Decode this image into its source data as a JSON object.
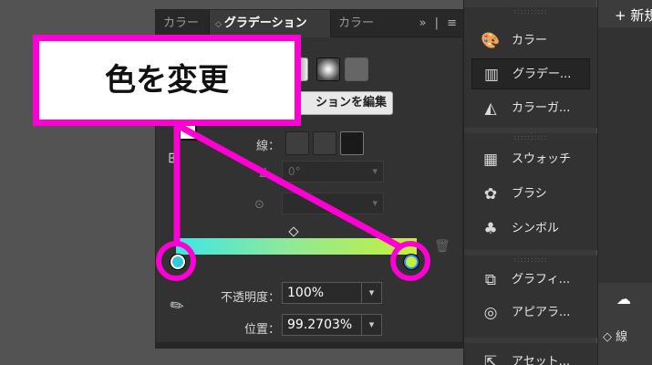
{
  "tabs": [
    {
      "label": "カラー",
      "state": "inactive"
    },
    {
      "label": "グラデーション",
      "state": "active"
    },
    {
      "label": "カラー",
      "state": "inactive"
    }
  ],
  "tab_tools": {
    "collapse": "»",
    "divider": "|",
    "menu": "≡"
  },
  "gradient_panel": {
    "edit_button_label": "ションを編集",
    "stroke_label": "線：",
    "angle_value": "0°",
    "aspect_value": "",
    "opacity_label": "不透明度：",
    "opacity_value": "100%",
    "position_label": "位置：",
    "position_value": "99.2703%",
    "stop_left_color": "#2fcbd8",
    "stop_right_color": "#c6ef3c"
  },
  "dock": {
    "items": [
      {
        "label": "カラー",
        "icon": "palette-icon"
      },
      {
        "label": "グラデー...",
        "icon": "gradient-icon",
        "active": true
      },
      {
        "label": "カラーガ...",
        "icon": "color-guide-icon"
      },
      {
        "label": "スウォッチ",
        "icon": "swatches-icon"
      },
      {
        "label": "ブラシ",
        "icon": "brush-icon"
      },
      {
        "label": "シンボル",
        "icon": "symbol-icon"
      },
      {
        "label": "グラフィ...",
        "icon": "graphic-styles-icon"
      },
      {
        "label": "アピアラ...",
        "icon": "appearance-icon"
      },
      {
        "label": "アセット...",
        "icon": "asset-export-icon"
      }
    ]
  },
  "right_strip": {
    "new_label": "+ 新規",
    "stroke_label": "線"
  },
  "annotation": {
    "callout_text": "色を変更",
    "accent": "#ff00d4"
  }
}
